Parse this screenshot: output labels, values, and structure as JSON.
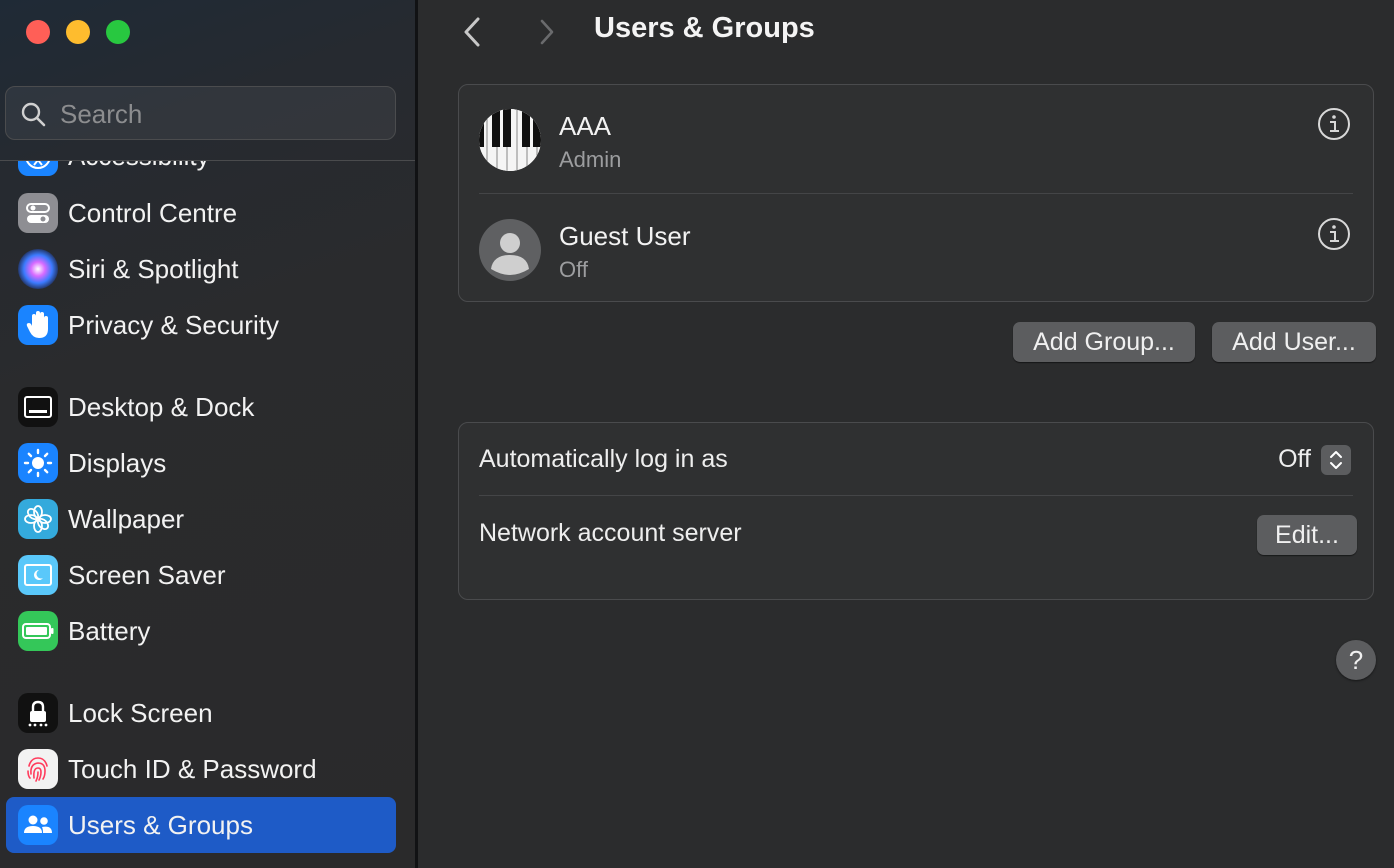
{
  "window": {
    "title": "Users & Groups"
  },
  "sidebar": {
    "search_placeholder": "Search",
    "items": [
      {
        "label": "Accessibility",
        "icon": "accessibility-icon",
        "color": "#1a84ff"
      },
      {
        "label": "Control Centre",
        "icon": "toggles-icon",
        "color": "#8e8e93"
      },
      {
        "label": "Siri & Spotlight",
        "icon": "siri-icon",
        "color": "#2a2a3a"
      },
      {
        "label": "Privacy & Security",
        "icon": "hand-icon",
        "color": "#1a84ff"
      },
      {
        "label": "Desktop & Dock",
        "icon": "dock-icon",
        "color": "#111111"
      },
      {
        "label": "Displays",
        "icon": "sun-icon",
        "color": "#1a84ff"
      },
      {
        "label": "Wallpaper",
        "icon": "flower-icon",
        "color": "#34aadc"
      },
      {
        "label": "Screen Saver",
        "icon": "screen-saver-icon",
        "color": "#5ac8fa"
      },
      {
        "label": "Battery",
        "icon": "battery-icon",
        "color": "#34c759"
      },
      {
        "label": "Lock Screen",
        "icon": "lock-icon",
        "color": "#111111"
      },
      {
        "label": "Touch ID & Password",
        "icon": "fingerprint-icon",
        "color": "#f2f2f2"
      },
      {
        "label": "Users & Groups",
        "icon": "users-icon",
        "color": "#1a84ff",
        "selected": true
      }
    ]
  },
  "users": [
    {
      "name": "AAA",
      "role": "Admin",
      "avatar": "piano-keys-avatar"
    },
    {
      "name": "Guest User",
      "role": "Off",
      "avatar": "person-silhouette-avatar"
    }
  ],
  "buttons": {
    "add_group": "Add Group...",
    "add_user": "Add User...",
    "edit": "Edit...",
    "help": "?"
  },
  "settings": {
    "auto_login_label": "Automatically log in as",
    "auto_login_value": "Off",
    "network_server_label": "Network account server"
  },
  "colors": {
    "accent": "#1e5bc7",
    "background": "#2b2c2d"
  }
}
